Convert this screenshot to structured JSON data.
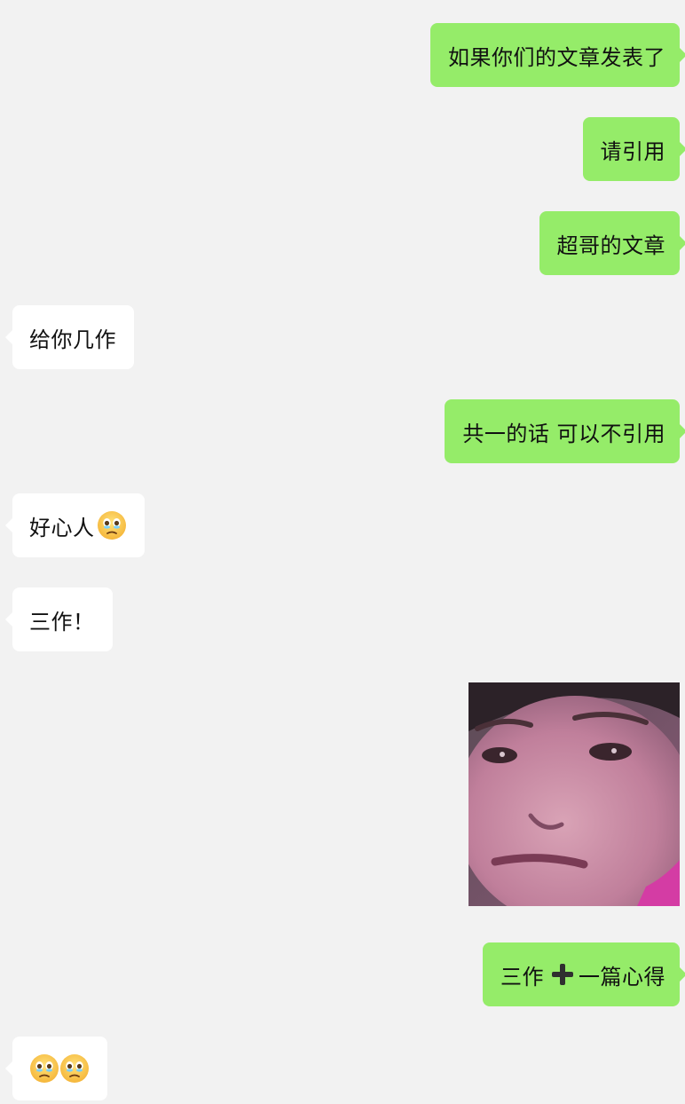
{
  "chat": {
    "messages": [
      {
        "side": "out",
        "text": "如果你们的文章发表了"
      },
      {
        "side": "out",
        "text": "请引用"
      },
      {
        "side": "out",
        "text": "超哥的文章"
      },
      {
        "side": "in",
        "text": "给你几作"
      },
      {
        "side": "out",
        "text": "共一的话 可以不引用"
      },
      {
        "side": "in",
        "text": "好心人",
        "emoji": "holding-back-tears-emoji"
      },
      {
        "side": "in",
        "text": "三作！"
      },
      {
        "side": "out",
        "type": "sticker",
        "sticker": "child-face-photo-sticker"
      },
      {
        "side": "out",
        "text_before": "三作",
        "icon": "heavy-plus-icon",
        "text_after": "一篇心得"
      },
      {
        "side": "in",
        "emoji": [
          "face-holding-back-tears-emoji",
          "face-holding-back-tears-emoji"
        ]
      }
    ]
  },
  "colors": {
    "background": "#f2f2f2",
    "outgoing_bubble": "#95ec69",
    "incoming_bubble": "#ffffff",
    "text": "#111111"
  }
}
